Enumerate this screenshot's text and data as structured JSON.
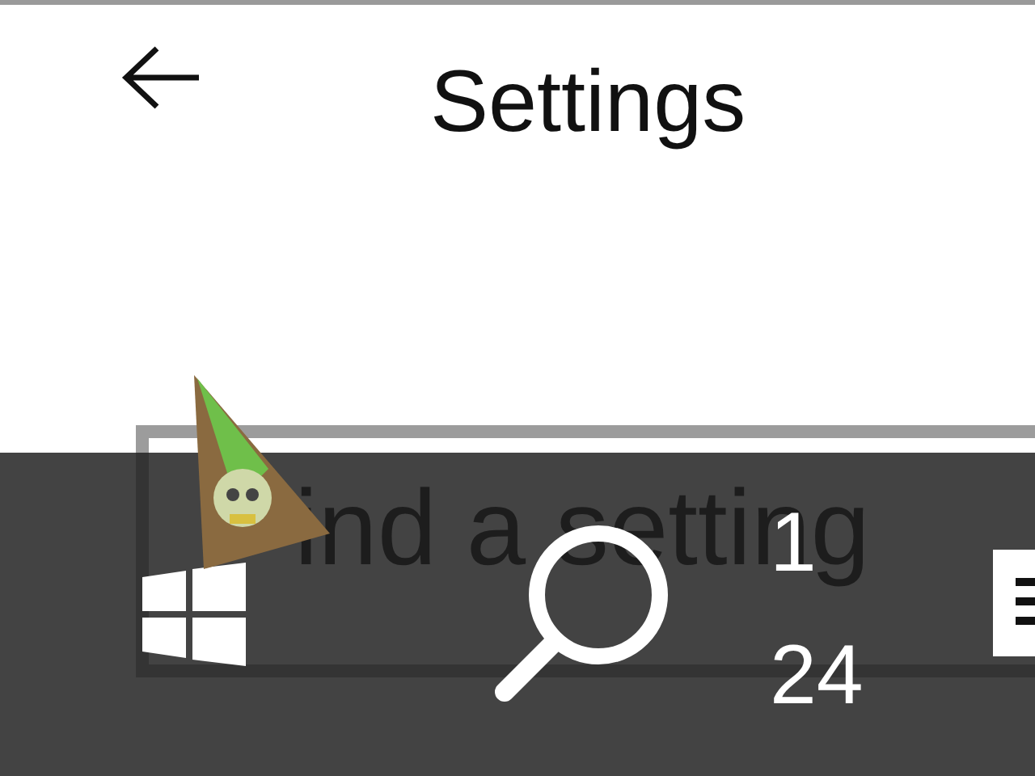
{
  "window": {
    "title": "Settings"
  },
  "search": {
    "placeholder": "ind a setting"
  },
  "taskbar": {
    "clock": [
      "1",
      "24"
    ]
  }
}
